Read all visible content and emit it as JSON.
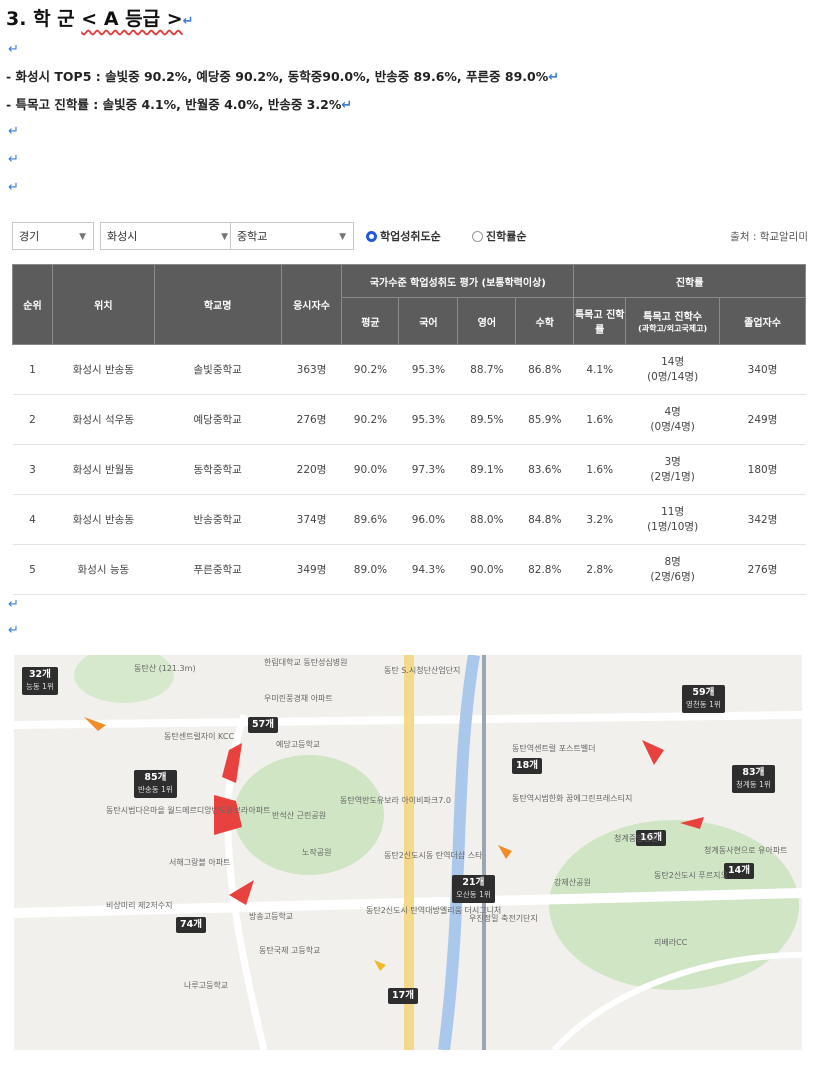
{
  "heading": {
    "number": "3.",
    "title": "학  군",
    "grade": "< A 등급 >"
  },
  "bullets": [
    "- 화성시 TOP5 : 솔빛중 90.2%, 예당중 90.2%, 동학중90.0%, 반송중 89.6%, 푸른중 89.0%",
    "- 특목고 진학률 : 솔빛중 4.1%, 반월중 4.0%, 반송중 3.2%"
  ],
  "filters": {
    "region": "경기",
    "city": "화성시",
    "level": "중학교",
    "option_score": "학업성취도순",
    "option_advance": "진학률순",
    "source": "출처 : 학교알리미"
  },
  "table": {
    "headers": {
      "rank": "순위",
      "location": "위치",
      "school": "학교명",
      "test_takers": "응시자수",
      "national_group": "국가수준 학업성취도 평가 (보통학력이상)",
      "avg": "평균",
      "korean": "국어",
      "english": "영어",
      "math": "수학",
      "advance_group": "진학률",
      "special_rate": "특목고 진학률",
      "special_count": "특목고 진학수",
      "special_count_sub": "(과학고/외고국제고)",
      "graduates": "졸업자수"
    },
    "rows": [
      {
        "rank": "1",
        "location": "화성시 반송동",
        "school": "솔빛중학교",
        "takers": "363명",
        "avg": "90.2%",
        "kor": "95.3%",
        "eng": "88.7%",
        "math": "86.8%",
        "rate": "4.1%",
        "count": "14명",
        "count_sub": "(0명/14명)",
        "grads": "340명"
      },
      {
        "rank": "2",
        "location": "화성시 석우동",
        "school": "예당중학교",
        "takers": "276명",
        "avg": "90.2%",
        "kor": "95.3%",
        "eng": "89.5%",
        "math": "85.9%",
        "rate": "1.6%",
        "count": "4명",
        "count_sub": "(0명/4명)",
        "grads": "249명"
      },
      {
        "rank": "3",
        "location": "화성시 반월동",
        "school": "동학중학교",
        "takers": "220명",
        "avg": "90.0%",
        "kor": "97.3%",
        "eng": "89.1%",
        "math": "83.6%",
        "rate": "1.6%",
        "count": "3명",
        "count_sub": "(2명/1명)",
        "grads": "180명"
      },
      {
        "rank": "4",
        "location": "화성시 반송동",
        "school": "반송중학교",
        "takers": "374명",
        "avg": "89.6%",
        "kor": "96.0%",
        "eng": "88.0%",
        "math": "84.8%",
        "rate": "3.2%",
        "count": "11명",
        "count_sub": "(1명/10명)",
        "grads": "342명"
      },
      {
        "rank": "5",
        "location": "화성시 능동",
        "school": "푸른중학교",
        "takers": "349명",
        "avg": "89.0%",
        "kor": "94.3%",
        "eng": "90.0%",
        "math": "82.8%",
        "rate": "2.8%",
        "count": "8명",
        "count_sub": "(2명/6명)",
        "grads": "276명"
      }
    ]
  },
  "map": {
    "tags": [
      {
        "count": "32개",
        "sub": "능동 1위"
      },
      {
        "count": "57개",
        "sub": ""
      },
      {
        "count": "85개",
        "sub": "반송동 1위"
      },
      {
        "count": "74개",
        "sub": ""
      },
      {
        "count": "18개",
        "sub": ""
      },
      {
        "count": "21개",
        "sub": "오산동 1위"
      },
      {
        "count": "17개",
        "sub": ""
      },
      {
        "count": "59개",
        "sub": "영천동 1위"
      },
      {
        "count": "83개",
        "sub": "청계동 1위"
      },
      {
        "count": "16개",
        "sub": ""
      },
      {
        "count": "14개",
        "sub": ""
      }
    ],
    "pois": [
      "동탄산 (121.3m)",
      "한림대학교 동탄성심병원",
      "동탄 S.시청단산업단지",
      "우미린풍경채 아파트",
      "예당고등학교",
      "동탄센트럴자이 KCC",
      "동탄시범다은마을 월드메르디앙반도유보라아파트",
      "반석산 근린공원",
      "노작공원",
      "서해그랑블 아파트",
      "동탄역반도유보라 아이비파크7.0",
      "동탄2신도시동 탄역더샵 스타",
      "동탄역센트럴 포스트벨더",
      "동탄역시범한화 꿈에그린프레스티지",
      "청계중앙공원",
      "청계동사현으로 유아파트",
      "동탄2신도시 푸르지오",
      "리베라CC",
      "강제산공원",
      "동탄2신도시 탄역대방엘리움 더시그니처",
      "동탄국제 고등학교",
      "나루고등학교",
      "방송고등학교",
      "비상미리 제2저수지",
      "우진정밀 축전기단지"
    ]
  }
}
